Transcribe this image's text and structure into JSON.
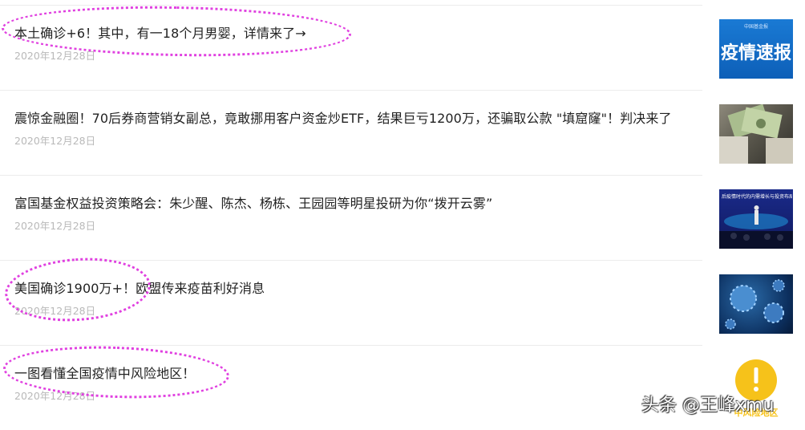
{
  "articles": [
    {
      "title": "本土确诊+6！其中，有一18个月男婴，详情来了→",
      "date": "2020年12月28日",
      "thumb": "疫情速报",
      "thumb_badge": "中国基金报"
    },
    {
      "title": "震惊金融圈！70后券商营销女副总，竟敢挪用客户资金炒ETF，结果巨亏1200万，还骗取公款 \"填窟窿\"！判决来了",
      "date": "2020年12月28日"
    },
    {
      "title": "富国基金权益投资策略会：朱少醒、陈杰、杨栋、王园园等明星投研为你“拨开云雾”",
      "date": "2020年12月28日",
      "thumb_caption": "后疫情时代的内需增长与投资布局"
    },
    {
      "title": "美国确诊1900万+！欧盟传来疫苗利好消息",
      "date": "2020年12月28日"
    },
    {
      "title": "一图看懂全国疫情中风险地区！",
      "date": "2020年12月28日",
      "thumb_caption": "中风险地区"
    }
  ],
  "watermark": "头条 @王峰xmu",
  "colors": {
    "highlight": "#e040e0",
    "date": "#b9b9b9",
    "title": "#222222"
  }
}
